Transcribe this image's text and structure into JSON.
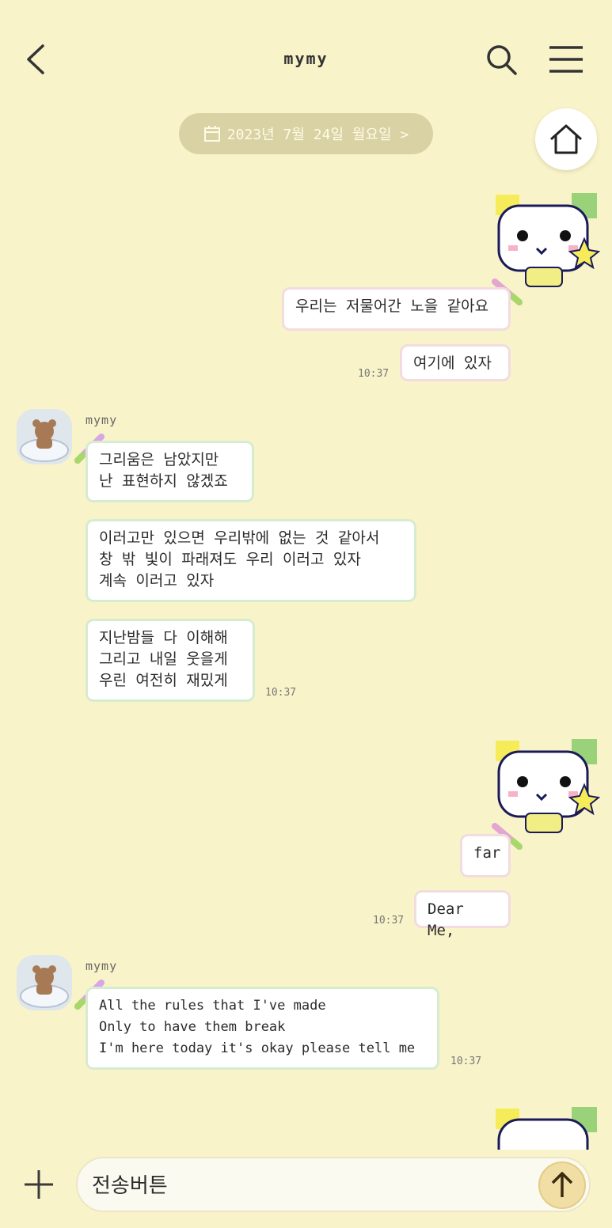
{
  "header": {
    "title": "mymy"
  },
  "date_pill": {
    "label": "2023년 7월 24일 월요일 >"
  },
  "messages": [
    {
      "text": "우리는 저물어간 노을 같아요"
    },
    {
      "text": "여기에 있자",
      "time": "10:37"
    },
    {
      "sender": "mymy",
      "text": "그리움은 남았지만\n난 표현하지 않겠죠"
    },
    {
      "text": "이러고만 있으면 우리밖에 없는 것 같아서\n창 밖 빛이 파래져도 우리 이러고 있자\n계속 이러고 있자"
    },
    {
      "text": "지난밤들 다 이해해\n그리고 내일 웃을게\n우린 여전히 재밌게",
      "time": "10:37"
    },
    {
      "text": "far"
    },
    {
      "text": "Dear Me,",
      "time": "10:37"
    },
    {
      "sender": "mymy",
      "text": "All the rules that I've made\nOnly to have them break\nI'm here today it's okay please tell me",
      "time": "10:37"
    }
  ],
  "composer": {
    "placeholder": "전송버튼"
  },
  "colors": {
    "background": "#f9f3c9",
    "pill": "#d9d2a4",
    "my_border": "#f2dcdf",
    "their_border": "#d6ecd0"
  }
}
